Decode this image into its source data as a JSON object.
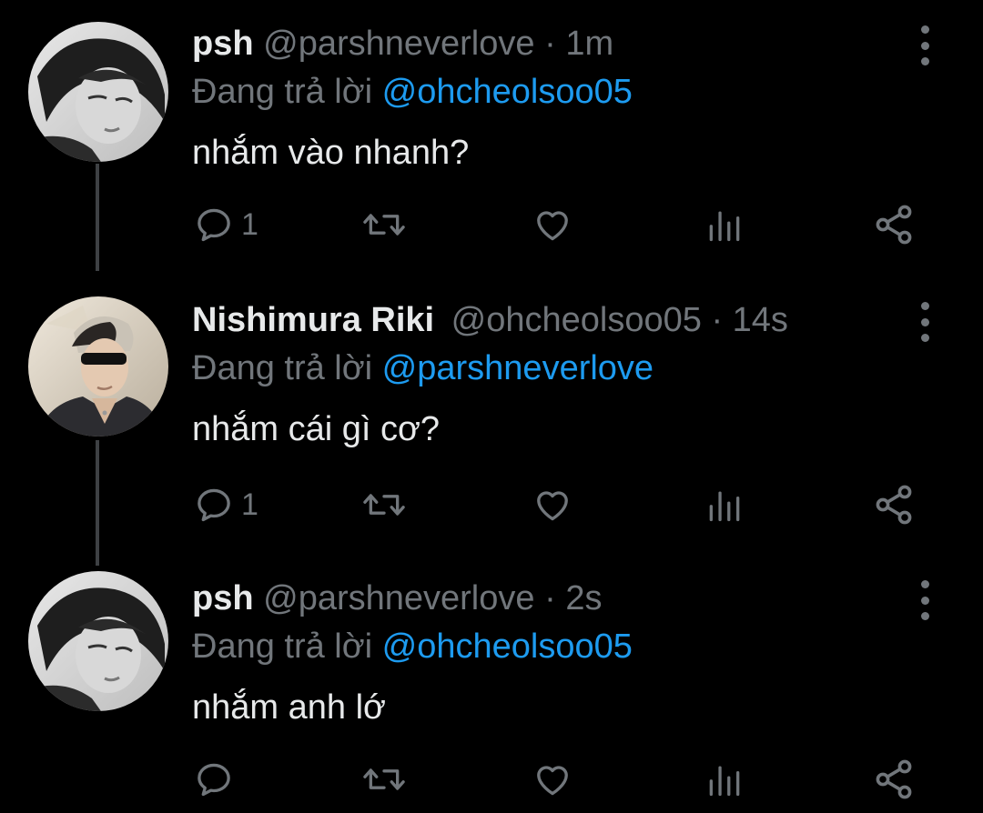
{
  "theme": {
    "background": "#000000",
    "text_primary": "#e7e9ea",
    "text_secondary": "#71767b",
    "mention": "#1d9bf0",
    "thread_line": "#3e4144"
  },
  "tweets": [
    {
      "display_name": "psh",
      "handle": "@parshneverlove",
      "separator": "·",
      "time": "1m",
      "reply_prefix": "Đang trả lời",
      "reply_to": "@ohcheolsoo05",
      "text": "nhắm vào nhanh?",
      "reply_count": "1",
      "avatar_icon": "avatar-grayscale-person"
    },
    {
      "display_name": "Nishimura Riki",
      "handle": "@ohcheolsoo05",
      "separator": "·",
      "time": "14s",
      "reply_prefix": "Đang trả lời",
      "reply_to": "@parshneverlove",
      "text": "nhắm cái gì cơ?",
      "reply_count": "1",
      "avatar_icon": "avatar-person-sunglasses"
    },
    {
      "display_name": "psh",
      "handle": "@parshneverlove",
      "separator": "·",
      "time": "2s",
      "reply_prefix": "Đang trả lời",
      "reply_to": "@ohcheolsoo05",
      "text": "nhắm anh lớ",
      "reply_count": "",
      "avatar_icon": "avatar-grayscale-person"
    }
  ],
  "icons": {
    "reply": "reply-icon",
    "retweet": "retweet-icon",
    "like": "like-icon",
    "views": "views-icon",
    "share": "share-icon",
    "more": "more-icon"
  }
}
